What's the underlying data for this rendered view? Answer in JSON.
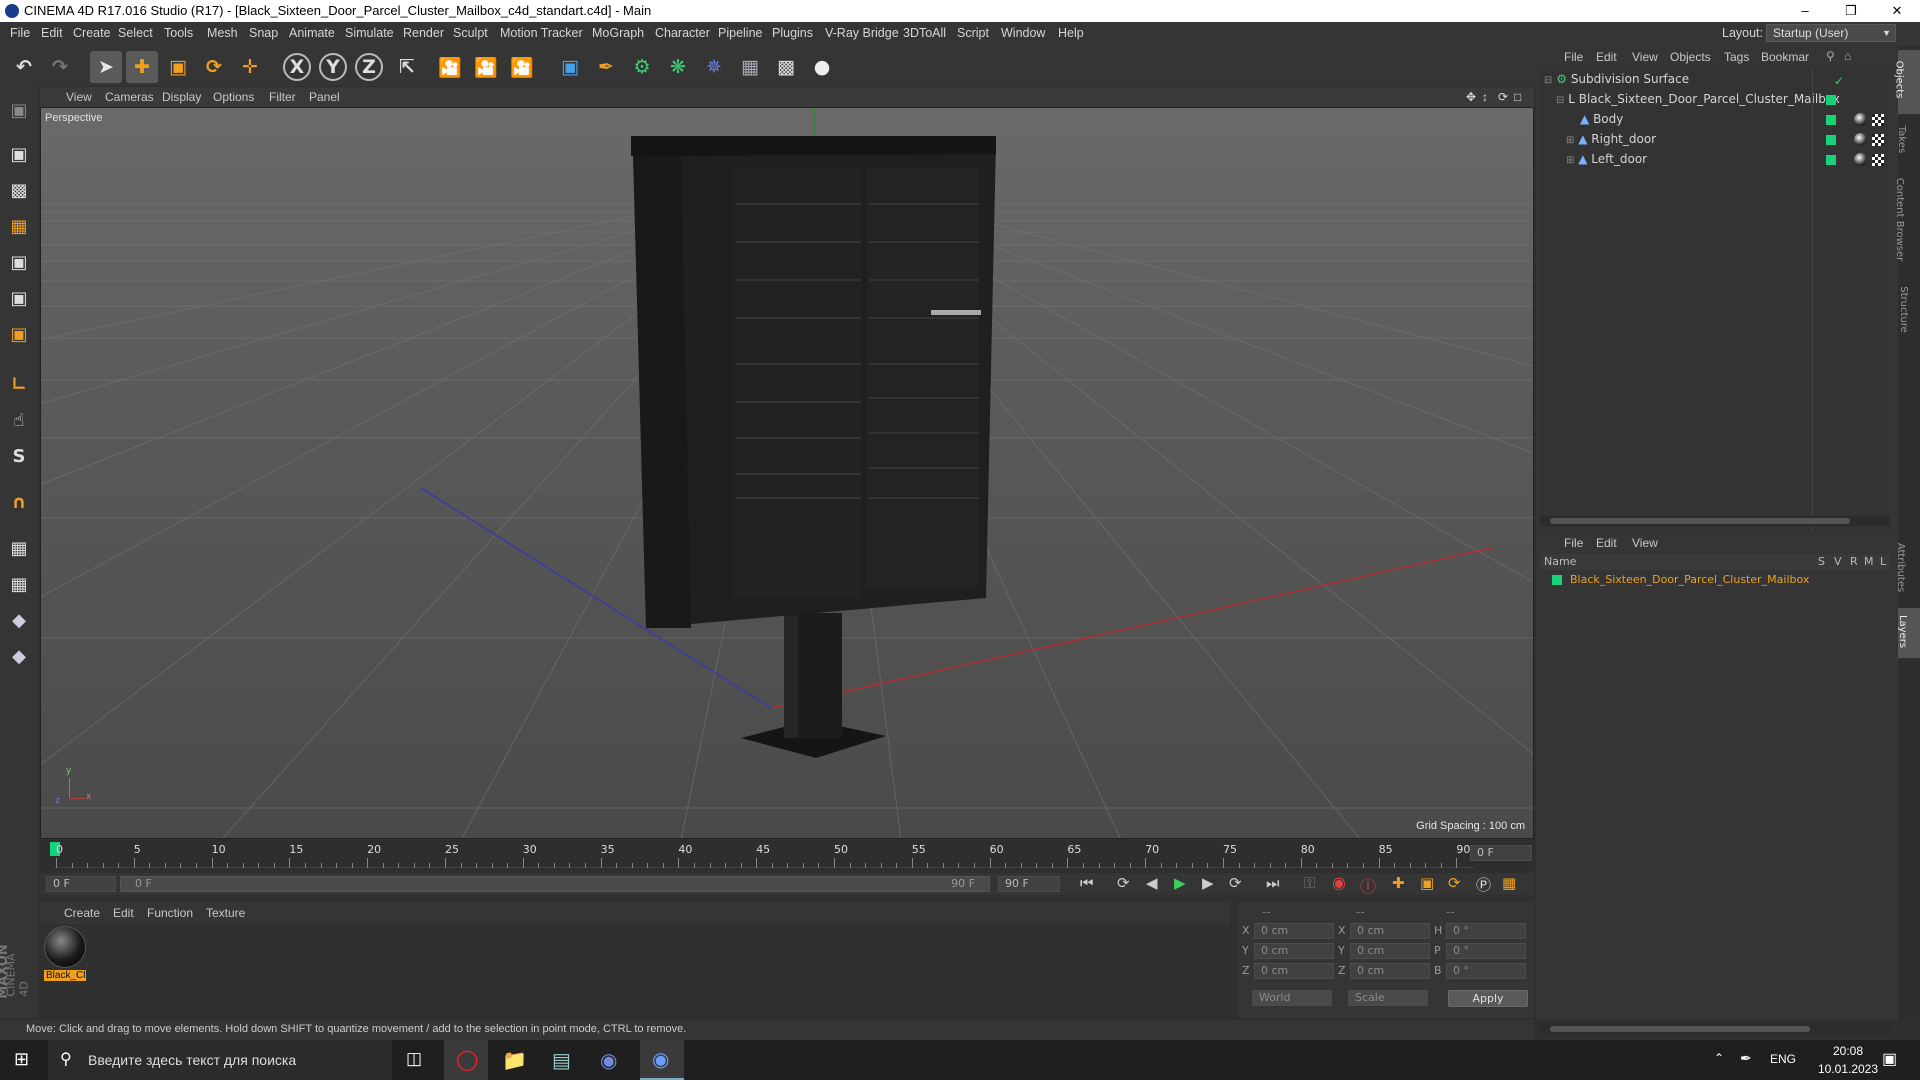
{
  "window": {
    "title": "CINEMA 4D R17.016 Studio (R17) - [Black_Sixteen_Door_Parcel_Cluster_Mailbox_c4d_standart.c4d] - Main"
  },
  "menu": [
    "File",
    "Edit",
    "Create",
    "Select",
    "Tools",
    "Mesh",
    "Snap",
    "Animate",
    "Simulate",
    "Render",
    "Sculpt",
    "Motion Tracker",
    "MoGraph",
    "Character",
    "Pipeline",
    "Plugins",
    "V-Ray Bridge",
    "3DToAll",
    "Script",
    "Window",
    "Help"
  ],
  "layout": {
    "label": "Layout:",
    "value": "Startup (User)"
  },
  "viewport": {
    "menu": [
      "View",
      "Cameras",
      "Display",
      "Options",
      "Filter",
      "Panel"
    ],
    "camera_label": "Perspective",
    "grid_spacing": "Grid Spacing : 100 cm",
    "axis_x": "x",
    "axis_y": "y",
    "axis_z": "z"
  },
  "timeline": {
    "ticks": [
      "0",
      "5",
      "10",
      "15",
      "20",
      "25",
      "30",
      "35",
      "40",
      "45",
      "50",
      "55",
      "60",
      "65",
      "70",
      "75",
      "80",
      "85",
      "90"
    ],
    "current_frame": "0 F",
    "start_field": "0 F",
    "slider_start": "0 F",
    "slider_end": "90 F",
    "end_field": "90 F"
  },
  "material_manager": {
    "menu": [
      "Create",
      "Edit",
      "Function",
      "Texture"
    ],
    "material_label": "Black_Cl"
  },
  "coordinates": {
    "headers": [
      "--",
      "--",
      "--"
    ],
    "rows": [
      {
        "a": "X",
        "av": "0 cm",
        "b": "X",
        "bv": "0 cm",
        "c": "H",
        "cv": "0 °"
      },
      {
        "a": "Y",
        "av": "0 cm",
        "b": "Y",
        "bv": "0 cm",
        "c": "P",
        "cv": "0 °"
      },
      {
        "a": "Z",
        "av": "0 cm",
        "b": "Z",
        "bv": "0 cm",
        "c": "B",
        "cv": "0 °"
      }
    ],
    "mode1": "World",
    "mode2": "Scale",
    "apply": "Apply"
  },
  "status": "Move: Click and drag to move elements. Hold down SHIFT to quantize movement / add to the selection in point mode, CTRL to remove.",
  "object_manager": {
    "menu": [
      "File",
      "Edit",
      "View",
      "Objects",
      "Tags",
      "Bookmar"
    ],
    "objects": [
      {
        "name": "Subdivision Surface"
      },
      {
        "name": "Black_Sixteen_Door_Parcel_Cluster_Mailbox"
      },
      {
        "name": "Body"
      },
      {
        "name": "Right_door"
      },
      {
        "name": "Left_door"
      }
    ]
  },
  "layer_manager": {
    "menu": [
      "File",
      "Edit",
      "View"
    ],
    "columns": [
      "Name",
      "S",
      "V",
      "R",
      "M",
      "L"
    ],
    "layer_name": "Black_Sixteen_Door_Parcel_Cluster_Mailbox"
  },
  "side_tabs": [
    "Objects",
    "Takes",
    "Content Browser",
    "Structure",
    "Attributes",
    "Layers"
  ],
  "brand": {
    "maxon": "MAXON",
    "c4d": "CINEMA 4D"
  },
  "taskbar": {
    "search_placeholder": "Введите здесь текст для поиска",
    "lang": "ENG",
    "time": "20:08",
    "date": "10.01.2023"
  },
  "colors": {
    "accent": "#f0a020",
    "green": "#18d27a",
    "layer_name": "#f0a020"
  }
}
